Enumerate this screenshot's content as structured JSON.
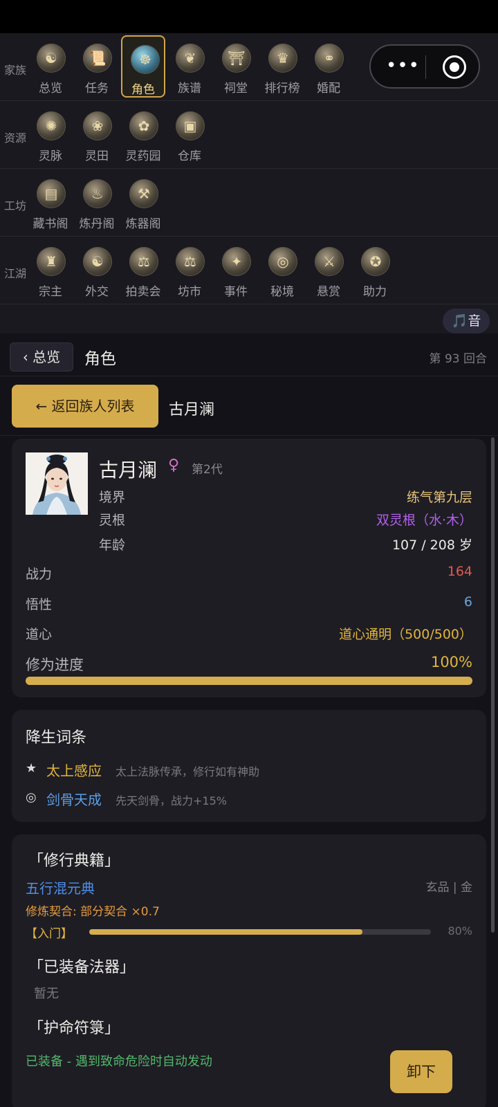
{
  "nav": {
    "rows": [
      {
        "label": "家族",
        "items": [
          {
            "label": "总览",
            "icon": "overview-icon",
            "glyph": "☯"
          },
          {
            "label": "任务",
            "icon": "task-icon",
            "glyph": "📜"
          },
          {
            "label": "角色",
            "icon": "character-icon",
            "glyph": "☸",
            "active": true
          },
          {
            "label": "族谱",
            "icon": "family-tree-icon",
            "glyph": "❦"
          },
          {
            "label": "祠堂",
            "icon": "shrine-icon",
            "glyph": "⛩"
          },
          {
            "label": "排行榜",
            "icon": "ranking-icon",
            "glyph": "♛"
          },
          {
            "label": "婚配",
            "icon": "marriage-icon",
            "glyph": "⚭"
          }
        ]
      },
      {
        "label": "资源",
        "items": [
          {
            "label": "灵脉",
            "icon": "spirit-vein-icon",
            "glyph": "✺"
          },
          {
            "label": "灵田",
            "icon": "spirit-field-icon",
            "glyph": "❀"
          },
          {
            "label": "灵药园",
            "icon": "herb-garden-icon",
            "glyph": "✿"
          },
          {
            "label": "仓库",
            "icon": "warehouse-icon",
            "glyph": "▣"
          }
        ]
      },
      {
        "label": "工坊",
        "items": [
          {
            "label": "藏书阁",
            "icon": "library-icon",
            "glyph": "▤"
          },
          {
            "label": "炼丹阁",
            "icon": "alchemy-icon",
            "glyph": "♨"
          },
          {
            "label": "炼器阁",
            "icon": "forge-icon",
            "glyph": "⚒"
          }
        ]
      },
      {
        "label": "江湖",
        "items": [
          {
            "label": "宗主",
            "icon": "sect-master-icon",
            "glyph": "♜"
          },
          {
            "label": "外交",
            "icon": "diplomacy-icon",
            "glyph": "☯"
          },
          {
            "label": "拍卖会",
            "icon": "auction-icon",
            "glyph": "⚖"
          },
          {
            "label": "坊市",
            "icon": "market-icon",
            "glyph": "⚖"
          },
          {
            "label": "事件",
            "icon": "event-icon",
            "glyph": "✦"
          },
          {
            "label": "秘境",
            "icon": "secret-realm-icon",
            "glyph": "◎"
          },
          {
            "label": "悬赏",
            "icon": "bounty-icon",
            "glyph": "⚔"
          },
          {
            "label": "助力",
            "icon": "assist-icon",
            "glyph": "✪"
          }
        ]
      }
    ],
    "capsule": {
      "more": "•••"
    },
    "sound": {
      "icon": "music-note-icon",
      "label": "🎵音"
    }
  },
  "header": {
    "back_label": "‹ 总览",
    "title": "角色",
    "round": "第 93 回合"
  },
  "subheader": {
    "return_label": "← 返回族人列表",
    "name": "古月澜"
  },
  "character": {
    "name": "古月澜",
    "gender_symbol": "♀",
    "generation": "第2代",
    "realm_label": "境界",
    "realm_value": "练气第九层",
    "root_label": "灵根",
    "root_value": "双灵根（水·木）",
    "age_label": "年龄",
    "age_value": "107 / 208 岁",
    "power_label": "战力",
    "power_value": "164",
    "comprehension_label": "悟性",
    "comprehension_value": "6",
    "dao_heart_label": "道心",
    "dao_heart_value": "道心通明（500/500）",
    "progress_label": "修为进度",
    "progress_value": "100%",
    "progress_fraction": 1.0
  },
  "traits": {
    "title": "降生词条",
    "items": [
      {
        "symbol": "★",
        "name": "太上感应",
        "desc": "太上法脉传承，修行如有神助",
        "color": "#e2b63c"
      },
      {
        "symbol": "◎",
        "name": "剑骨天成",
        "desc": "先天剑骨，战力+15%",
        "color": "#5b9ee6"
      }
    ]
  },
  "equipment": {
    "manual_title": "「修行典籍」",
    "manual_name": "五行混元典",
    "manual_grade": "玄品 | 金",
    "manual_affinity": "修炼契合: 部分契合 ×0.7",
    "manual_stage": "【入门】",
    "manual_progress_text": "80%",
    "manual_progress_fraction": 0.8,
    "artifact_title": "「已装备法器」",
    "artifact_value": "暂无",
    "talisman_title": "「护命符箓」",
    "talisman_status": "已装备 - 遇到致命危险时自动发动",
    "unequip_label": "卸下"
  },
  "colors": {
    "accent_gold": "#d5ac4c",
    "realm": "#e7c27a",
    "root": "#b061ea",
    "power": "#e05a50",
    "comprehension": "#6ba6dd",
    "dao_heart": "#e2b63c",
    "manual_name": "#4f8ee8",
    "affinity": "#e59b3e",
    "equipped": "#52b86a"
  }
}
